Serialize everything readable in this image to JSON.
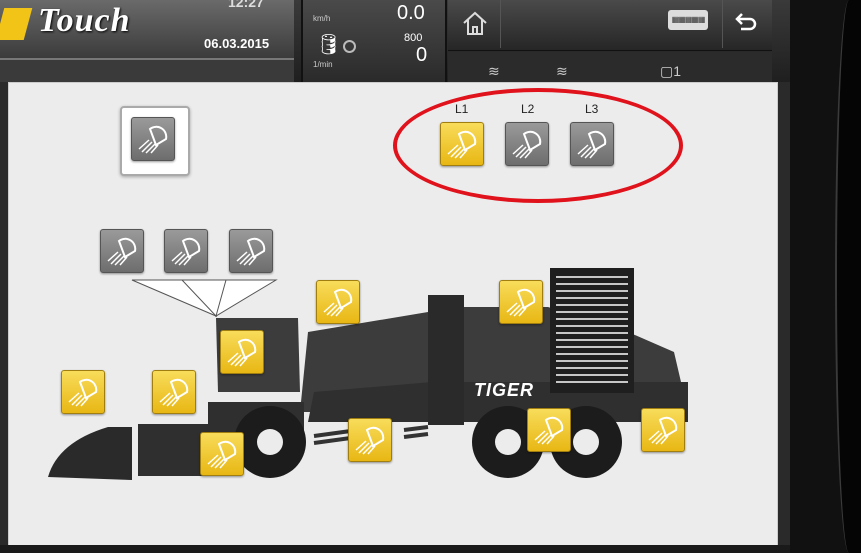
{
  "header": {
    "logo_text": "Touch",
    "time_fragment": "12:27",
    "date": "06.03.2015",
    "speed_unit": "km/h",
    "speed_value": "0.0",
    "rpm_max": "800",
    "rpm_value": "0",
    "rpm_unit": "1/min",
    "keyboard_keys": "▦▦▦▦▦",
    "strip_labels": [
      "≋",
      "≋",
      "▢1"
    ]
  },
  "lights": {
    "groups": [
      {
        "label": "L1",
        "state": "on"
      },
      {
        "label": "L2",
        "state": "off"
      },
      {
        "label": "L3",
        "state": "off"
      }
    ],
    "master_state": "off",
    "machine_lamps_top": [
      "off",
      "off",
      "off"
    ],
    "machine_lamps": [
      "on",
      "on",
      "on",
      "on",
      "on",
      "on",
      "on",
      "on",
      "on"
    ]
  },
  "machine": {
    "brand": "TIGER"
  },
  "colors": {
    "lamp_on": "#f2c417",
    "lamp_off": "#7d7d7d",
    "highlight_ring": "#e0121b",
    "panel_bg": "#ececec"
  },
  "icons": {
    "home": "home-icon",
    "keyboard": "keyboard-icon",
    "back": "back-arrow-icon",
    "lamp": "work-light-icon"
  }
}
